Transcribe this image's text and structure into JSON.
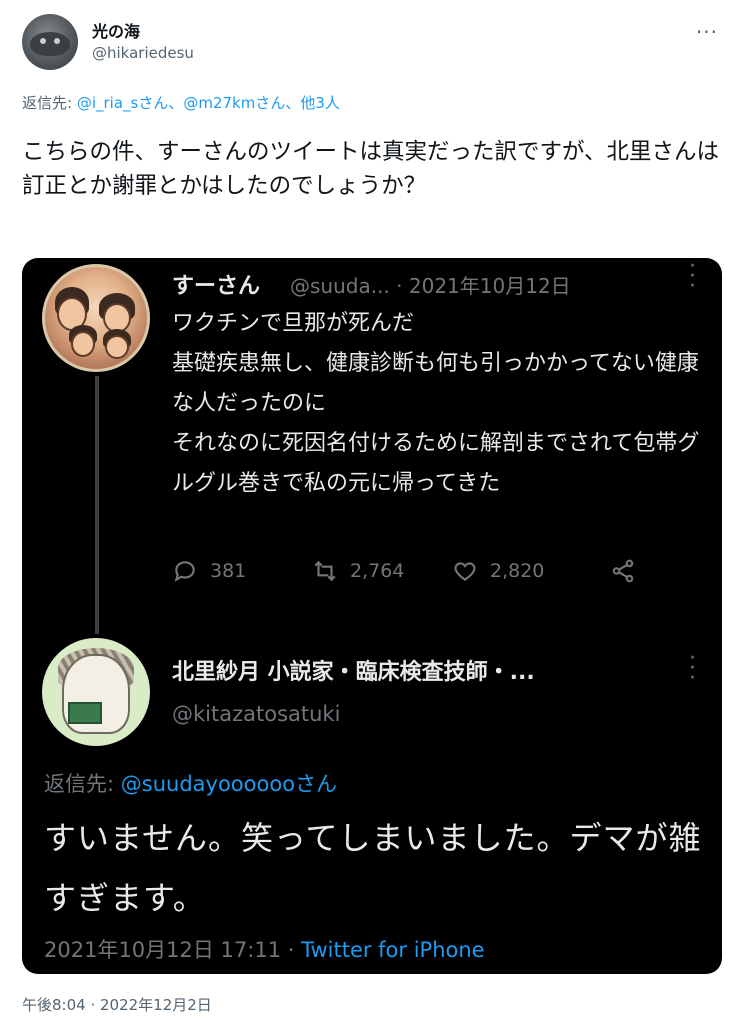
{
  "author": {
    "display_name": "光の海",
    "handle": "@hikariedesu",
    "avatar_icon": "avatar-icon"
  },
  "reply_to": {
    "prefix": "返信先: ",
    "mention1": "@i_ria_s",
    "suffix1": "さん、",
    "mention2": "@m27km",
    "suffix2": "さん、",
    "others": "他3人"
  },
  "tweet_text": "こちらの件、すーさんのツイートは真実だった訳ですが、北里さんは訂正とか謝罪とかはしたのでしょうか？",
  "embedded": {
    "tweet1": {
      "name": "すーさん",
      "handle_date": "@suuda... · 2021年10月12日",
      "text": "ワクチンで旦那が死んだ\n基礎疾患無し、健康診断も何も引っかかってない健康な人だったのに\nそれなのに死因名付けるために解剖までされて包帯グルグル巻きで私の元に帰ってきた",
      "replies": "381",
      "retweets": "2,764",
      "likes": "2,820"
    },
    "tweet2": {
      "name": "北里紗月 小説家・臨床検査技師・...",
      "handle": "@kitazatosatuki",
      "reply_prefix": "返信先: ",
      "reply_mention": "@suudayoooooo",
      "reply_suffix": "さん",
      "text": "すいません。笑ってしまいました。デマが雑すぎます。",
      "footer_date": "2021年10月12日 17:11 · ",
      "footer_source": "Twitter for iPhone"
    }
  },
  "timestamp": "午後8:04 · 2022年12月2日",
  "colors": {
    "accent": "#1d9bf0",
    "embed_bg": "#000000"
  }
}
